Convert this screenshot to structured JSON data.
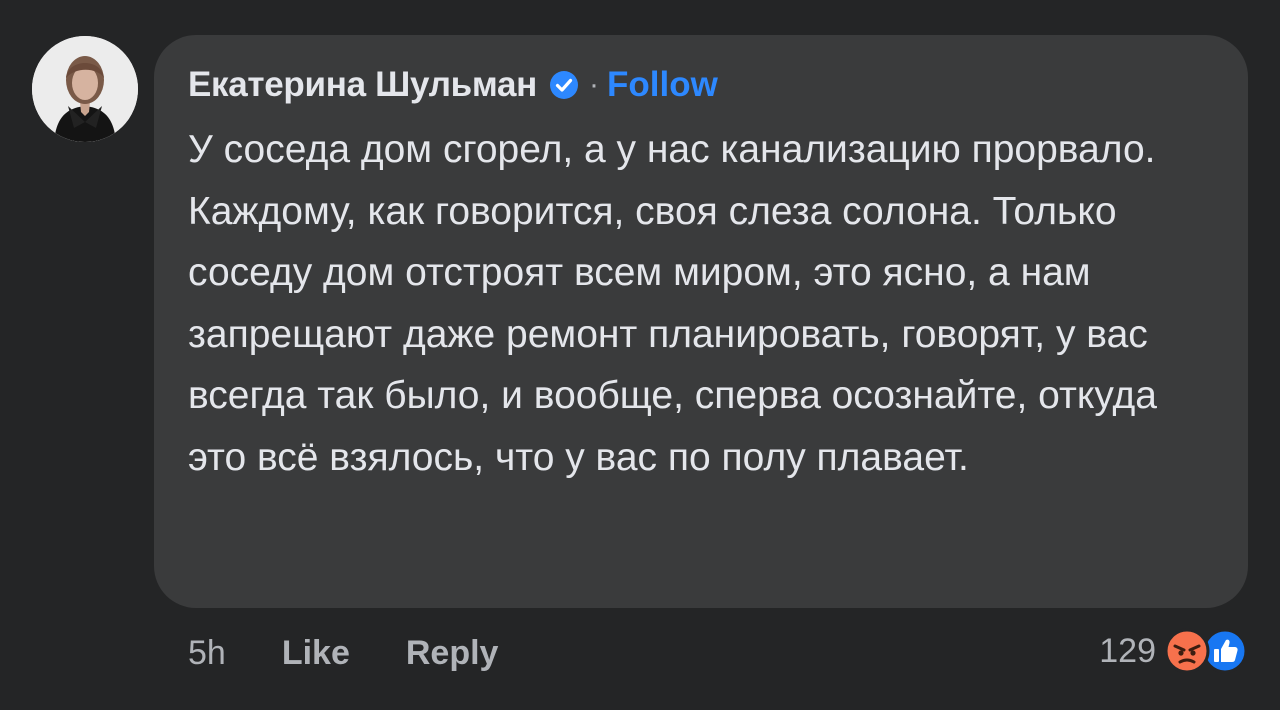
{
  "comment": {
    "author_name": "Екатерина Шульман",
    "separator": "·",
    "follow_label": "Follow",
    "text": "У соседа дом сгорел, а у нас канализацию прорвало. Каждому, как говорится, своя слеза солона. Только соседу дом отстроят всем миром, это ясно, а нам запрещают даже ремонт планировать, говорят, у вас всегда так было, и вообще, сперва осознайте, откуда это всё взялось, что у вас по полу плавает."
  },
  "footer": {
    "time": "5h",
    "like_label": "Like",
    "reply_label": "Reply"
  },
  "reactions": {
    "count": "129",
    "icons": [
      "angry-reaction-icon",
      "like-reaction-icon"
    ]
  },
  "colors": {
    "background": "#242526",
    "bubble": "#3a3b3c",
    "text_primary": "#e4e6eb",
    "text_secondary": "#b0b3b8",
    "link": "#2d88ff",
    "verified": "#2d88ff",
    "angry": "#f7714c",
    "like": "#1877f2"
  }
}
